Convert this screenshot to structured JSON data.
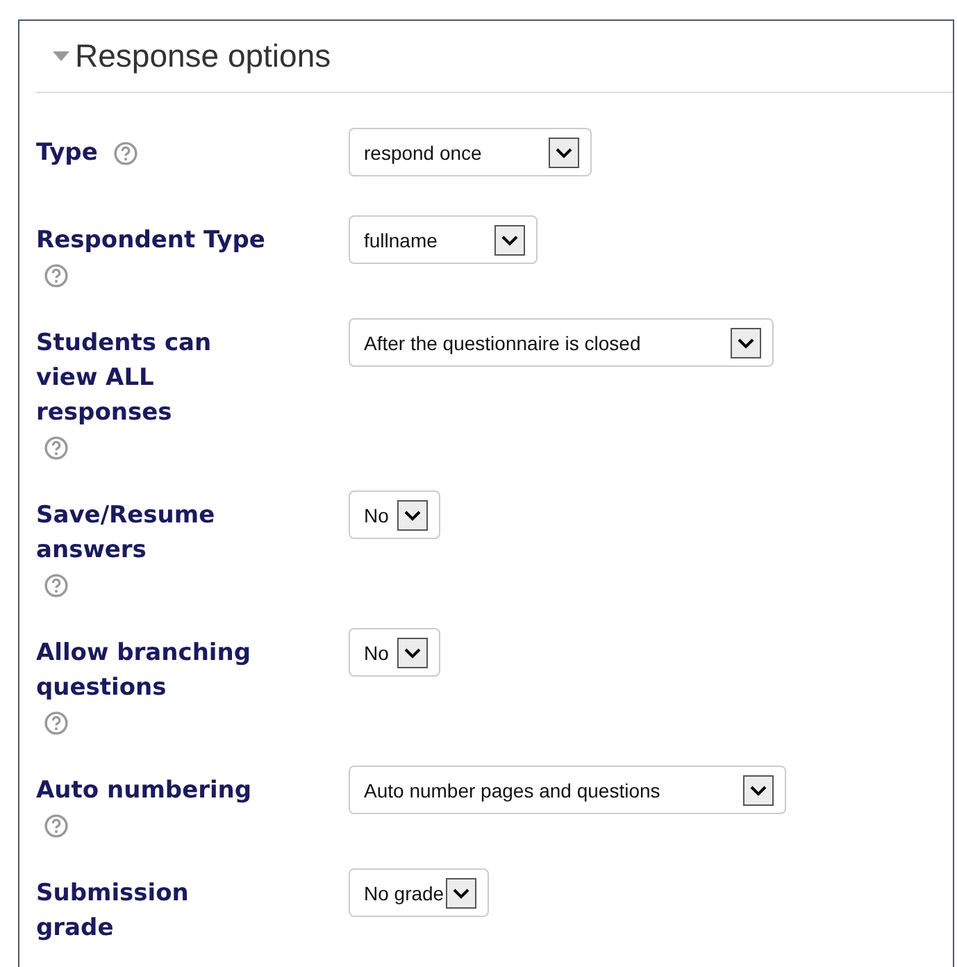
{
  "section": {
    "title": "Response options",
    "expanded": true
  },
  "fields": [
    {
      "label": "Type",
      "value": "respond once",
      "help": true
    },
    {
      "label": "Respondent Type",
      "value": "fullname",
      "help": true
    },
    {
      "label": "Students can view ALL responses",
      "value": "After the questionnaire is closed",
      "help": true
    },
    {
      "label": "Save/Resume answers",
      "value": "No",
      "help": true
    },
    {
      "label": "Allow branching questions",
      "value": "No",
      "help": true
    },
    {
      "label": "Auto numbering",
      "value": "Auto number pages and questions",
      "help": true
    },
    {
      "label": "Submission grade",
      "value": "No grade",
      "help": false
    }
  ]
}
